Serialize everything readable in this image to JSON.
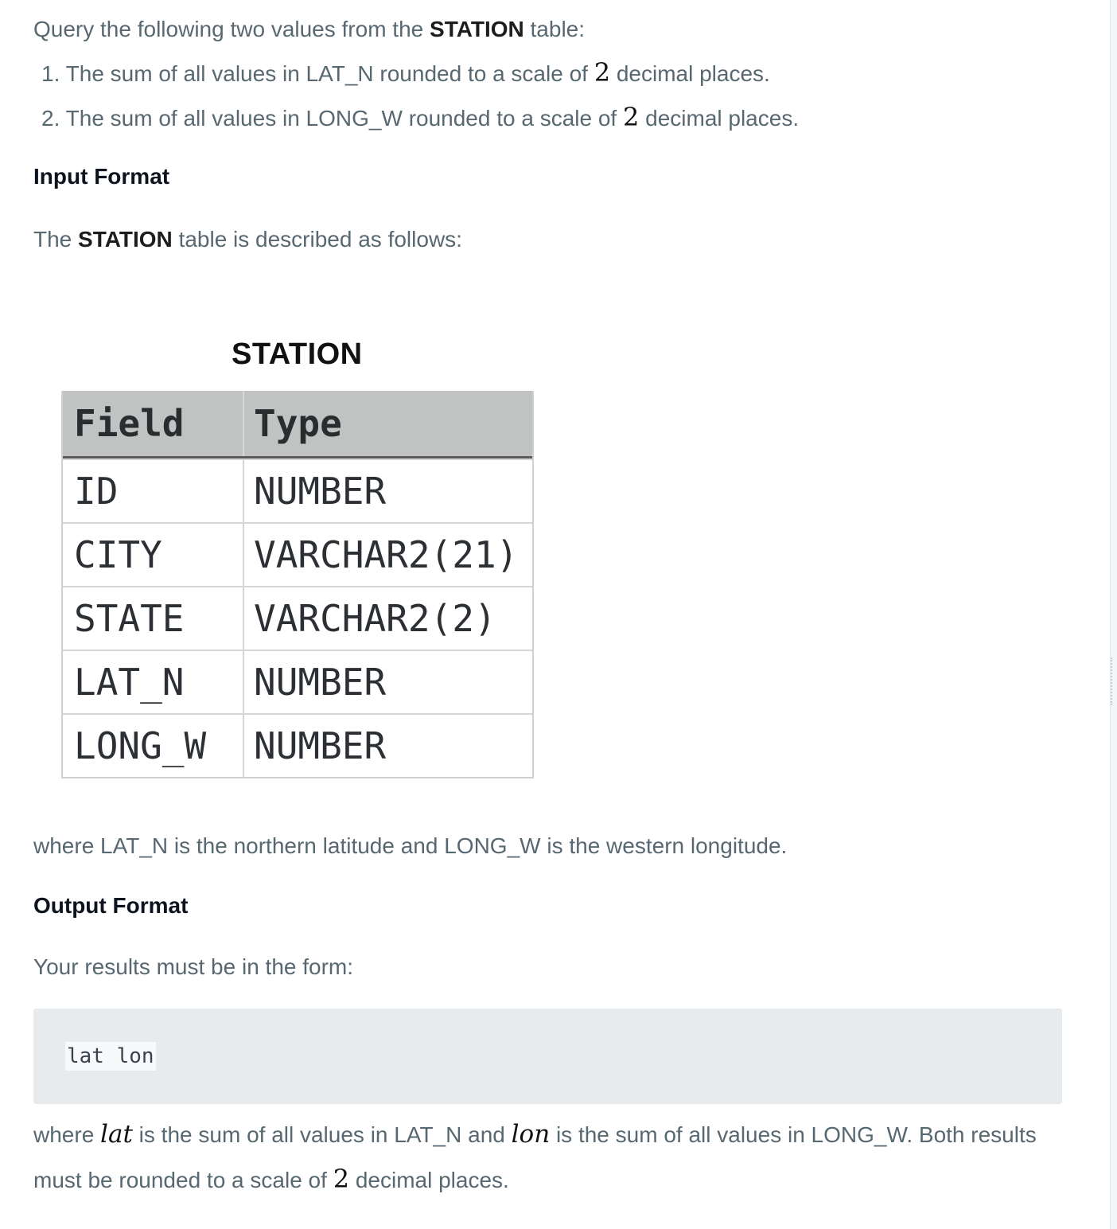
{
  "intro": {
    "prefix": "Query the following two values from the ",
    "table_name": "STATION",
    "suffix": " table:"
  },
  "list": [
    {
      "num": "1.",
      "before": "The sum of all values in LAT_N rounded to a scale of ",
      "math": "2",
      "after": " decimal places."
    },
    {
      "num": "2.",
      "before": "The sum of all values in LONG_W rounded to a scale of ",
      "math": "2",
      "after": " decimal places."
    }
  ],
  "input_format": {
    "heading": "Input Format",
    "desc_prefix": "The ",
    "desc_bold": "STATION",
    "desc_suffix": " table is described as follows:"
  },
  "station_table": {
    "title": "STATION",
    "headers": [
      "Field",
      "Type"
    ],
    "rows": [
      [
        "ID",
        "NUMBER"
      ],
      [
        "CITY",
        "VARCHAR2(21)"
      ],
      [
        "STATE",
        "VARCHAR2(2)"
      ],
      [
        "LAT_N",
        "NUMBER"
      ],
      [
        "LONG_W",
        "NUMBER"
      ]
    ]
  },
  "where_text": "where LAT_N is the northern latitude and LONG_W is the western longitude.",
  "output_format": {
    "heading": "Output Format",
    "desc": "Your results must be in the form:",
    "code": "lat lon",
    "final_1_prefix": "where ",
    "final_1_lat": "lat",
    "final_1_mid": " is the sum of all values in LAT_N and ",
    "final_1_lon": "lon",
    "final_1_suffix": " is the sum of all values in LONG_W. Both results",
    "final_2_prefix": "must be rounded to a scale of ",
    "final_2_math": "2",
    "final_2_suffix": " decimal places."
  },
  "colors": {
    "body_text": "#576871",
    "heading": "#0e141e",
    "table_header_bg": "#c1c2c2",
    "code_bg": "#e7ebee"
  }
}
